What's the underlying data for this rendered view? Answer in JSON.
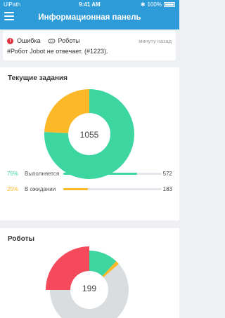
{
  "status_bar": {
    "carrier": "UiPath",
    "time": "9:41 AM",
    "battery": "100%"
  },
  "header": {
    "title": "Информационная панель"
  },
  "notification": {
    "level": "Ошибка",
    "source": "Роботы",
    "time": "минуту назад",
    "message": "#Робот Jobot не отвечает. (#1223)."
  },
  "tasks_card": {
    "title": "Текущие задания",
    "total": "1055",
    "colors": {
      "running": "#3dd6a0",
      "pending": "#fbb829"
    },
    "legend": [
      {
        "pct": "75%",
        "label": "Выполняется",
        "count": "572",
        "fraction": 0.75,
        "color": "#3dd6a0"
      },
      {
        "pct": "25%",
        "label": "В ожидании",
        "count": "183",
        "fraction": 0.25,
        "color": "#fbb829"
      }
    ],
    "segments": [
      {
        "name": "running",
        "value": 572,
        "color": "#3dd6a0"
      },
      {
        "name": "pending",
        "value": 183,
        "color": "#fbb829"
      }
    ]
  },
  "robots_card": {
    "title": "Роботы",
    "total": "199",
    "segments": [
      {
        "name": "green",
        "fraction": 0.12,
        "color": "#3dd6a0"
      },
      {
        "name": "yellow",
        "fraction": 0.015,
        "color": "#fbb829"
      },
      {
        "name": "gray",
        "fraction": 0.615,
        "color": "#d9dde0"
      },
      {
        "name": "red",
        "fraction": 0.25,
        "color": "#f44a5c"
      }
    ]
  }
}
